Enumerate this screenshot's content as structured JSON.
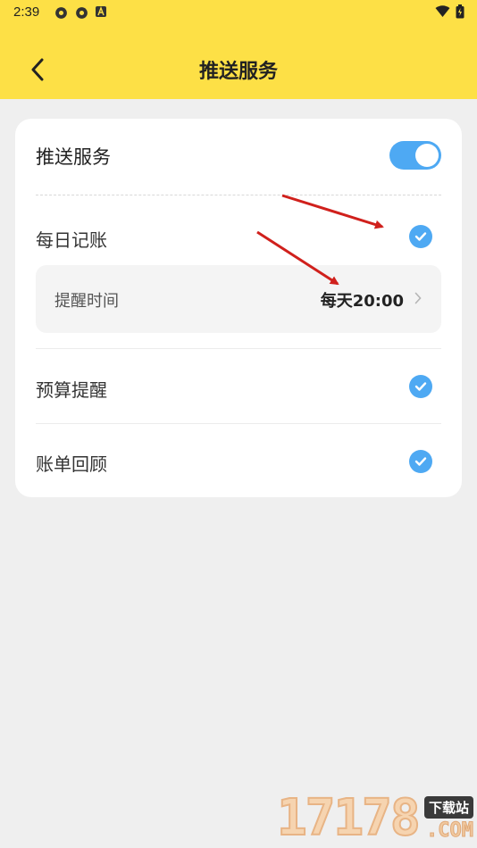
{
  "status_bar": {
    "time": "2:39",
    "icons_left": [
      "settings-gear-icon",
      "settings-gear-icon",
      "font-a-icon"
    ],
    "icons_right": [
      "wifi-icon",
      "battery-icon"
    ]
  },
  "header": {
    "title": "推送服务",
    "back_icon": "chevron-left-icon",
    "background_color": "#fde046"
  },
  "push_service": {
    "label": "推送服务",
    "enabled": true,
    "toggle_color": "#4ea9f3"
  },
  "items": [
    {
      "label": "每日记账",
      "checked": true
    },
    {
      "label": "预算提醒",
      "checked": true
    },
    {
      "label": "账单回顾",
      "checked": true
    }
  ],
  "reminder": {
    "label": "提醒时间",
    "value": "每天20:00"
  },
  "watermark": {
    "digits": "17178",
    "tag": "下载站",
    "domain": ".COM"
  }
}
